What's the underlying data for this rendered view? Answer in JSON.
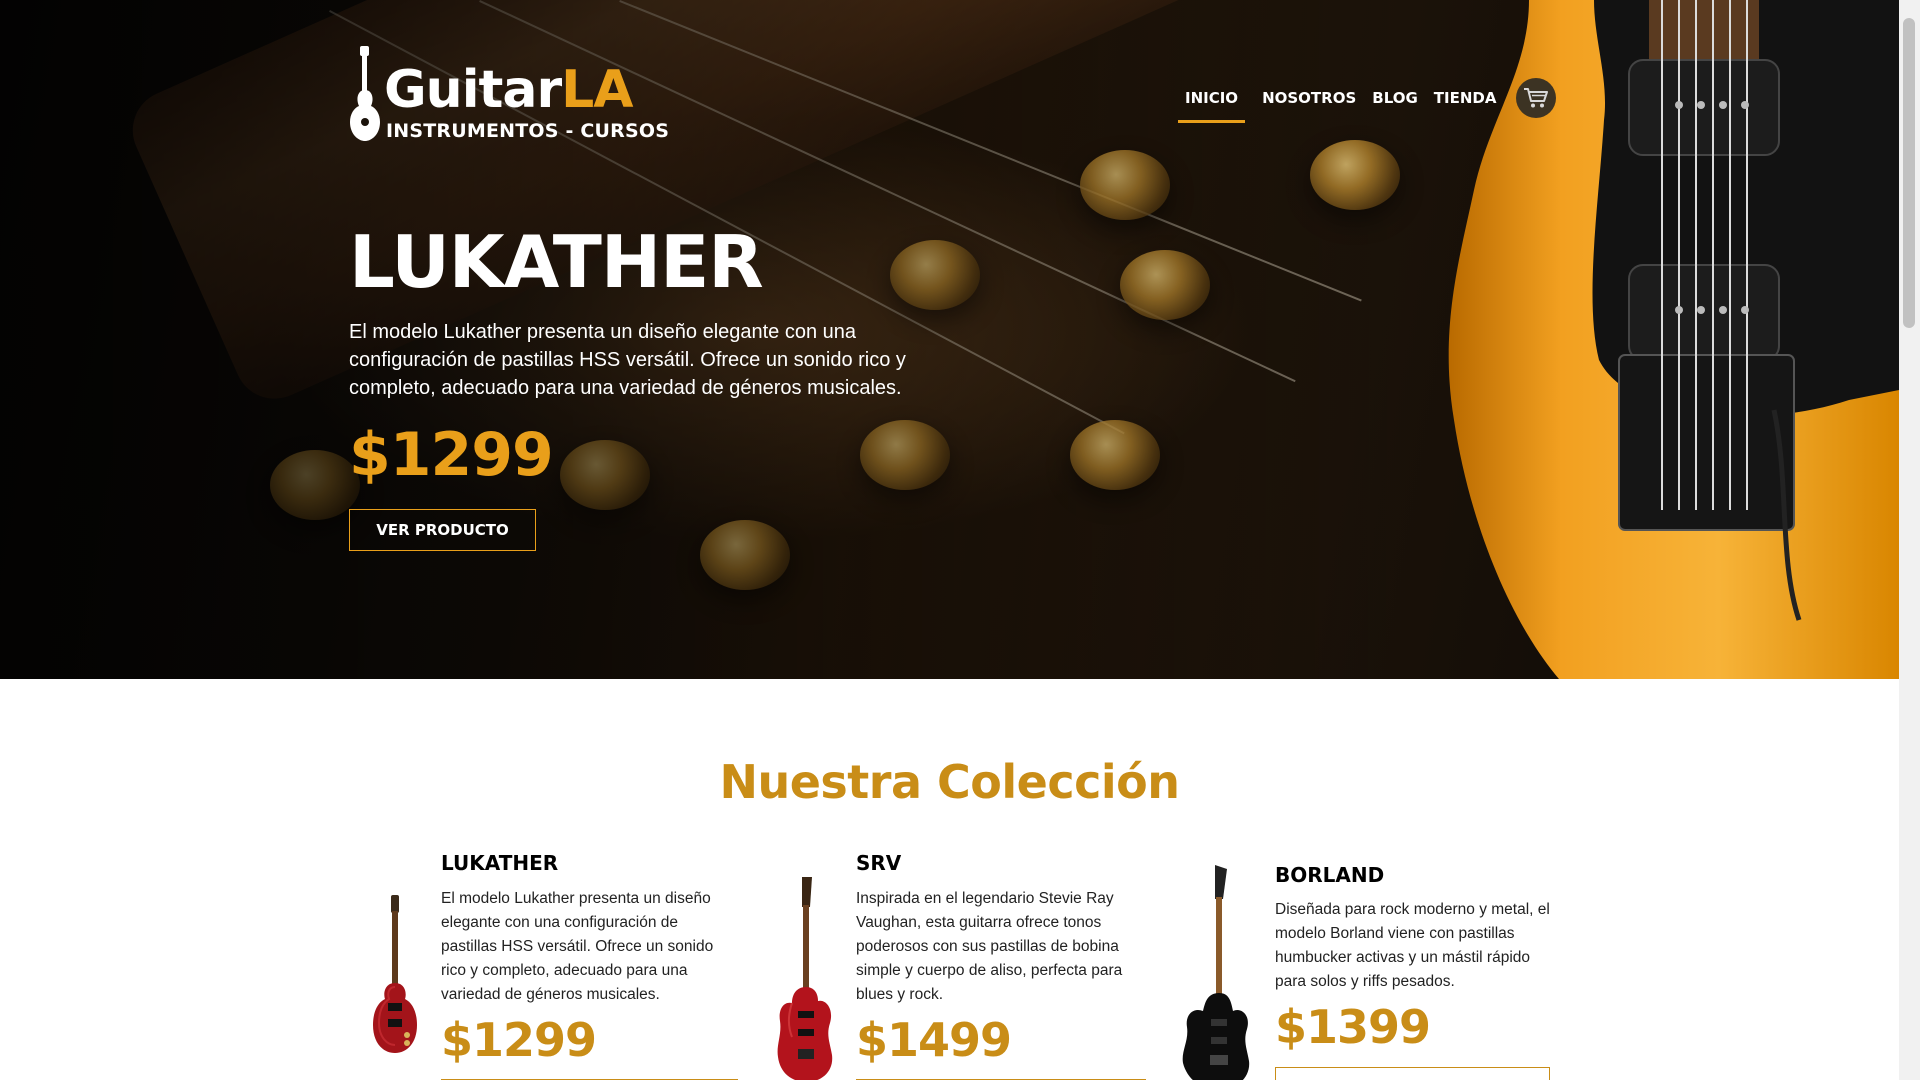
{
  "brand": {
    "name_part1": "Guitar",
    "name_part2": "LA",
    "tagline": "INSTRUMENTOS - CURSOS",
    "accent_color": "#e99f1a",
    "logo_icon": "guitar-silhouette-icon"
  },
  "nav": {
    "items": [
      {
        "label": "INICIO",
        "active": true
      },
      {
        "label": "NOSOTROS",
        "active": false
      },
      {
        "label": "BLOG",
        "active": false
      },
      {
        "label": "TIENDA",
        "active": false
      }
    ],
    "cart_icon": "cart-icon"
  },
  "hero": {
    "title": "LUKATHER",
    "description": "El modelo Lukather presenta un diseño elegante con una configuración de pastillas HSS versátil. Ofrece un sonido rico y completo, adecuado para una variedad de géneros musicales.",
    "price": "$1299",
    "cta_label": "VER PRODUCTO"
  },
  "collection": {
    "title": "Nuestra Colección",
    "products": [
      {
        "name": "LUKATHER",
        "description": "El modelo Lukather presenta un diseño elegante con una configuración de pastillas HSS versátil. Ofrece un sonido rico y completo, adecuado para una variedad de géneros musicales.",
        "price": "$1299",
        "image_icon": "red-les-paul-guitar-icon"
      },
      {
        "name": "SRV",
        "description": "Inspirada en el legendario Stevie Ray Vaughan, esta guitarra ofrece tonos poderosos con sus pastillas de bobina simple y cuerpo de aliso, perfecta para blues y rock.",
        "price": "$1499",
        "image_icon": "red-stratocaster-guitar-icon"
      },
      {
        "name": "BORLAND",
        "description": "Diseñada para rock moderno y metal, el modelo Borland viene con pastillas humbucker activas y un mástil rápido para solos y riffs pesados.",
        "price": "$1399",
        "image_icon": "black-superstrat-guitar-icon"
      }
    ]
  },
  "colors": {
    "accent": "#e99f1a",
    "section_heading": "#c98d17",
    "hero_bg": "#1a120a"
  }
}
